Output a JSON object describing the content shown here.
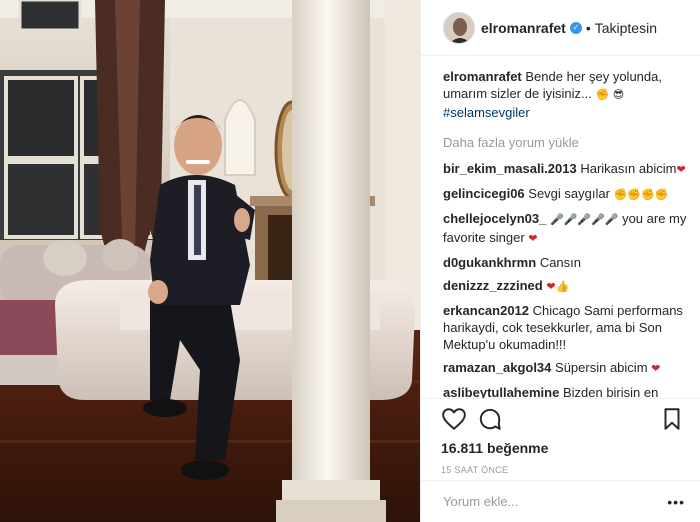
{
  "colors": {
    "link": "#003569",
    "verified": "#3897f0",
    "muted": "#999999",
    "text": "#262626"
  },
  "post": {
    "author": "elromanrafet",
    "follow_status": "Takiptesin",
    "dot": "•",
    "caption": {
      "user": "elromanrafet",
      "text": "Bende her şey yolunda, umarım sizler de iyisiniz...",
      "emojis": [
        "fist-emoji",
        "sunglasses-emoji"
      ],
      "hashtag": "#selamsevgiler"
    },
    "load_more": "Daha fazla yorum yükle",
    "comments": [
      {
        "user": "bir_ekim_masali.2013",
        "text": "Harikasın abicim",
        "emoji": "❤"
      },
      {
        "user": "gelincicegi06",
        "text": "Sevgi saygılar",
        "emoji": "✊✊✊✊"
      },
      {
        "user": "chellejocelyn03_",
        "text": "you are my favorite singer",
        "emoji_pre": "🎤🎤🎤🎤🎤",
        "emoji": "❤"
      },
      {
        "user": "d0gukankhrmn",
        "text": "Cansın",
        "emoji": ""
      },
      {
        "user": "denizzz_zzzined",
        "text": "",
        "emoji": "❤👍"
      },
      {
        "user": "erkancan2012",
        "text": "Chicago Sami performans harikaydi, cok tesekkurler, ama bi Son Mektup'u okumadin!!!",
        "emoji": ""
      },
      {
        "user": "ramazan_akgol34",
        "text": "Süpersin abicim",
        "emoji": "❤"
      },
      {
        "user": "aslibeytullahemine",
        "text": "Bizden birisin en çokta bu hayranlık yapıyor ... doğal alçak gönüllü halktan gelen ve geldiği yeri unutmayan bi",
        "emoji": ""
      }
    ],
    "likes": "16.811 beğenme",
    "time": "15 SAAT ÖNCE",
    "add_comment_placeholder": "Yorum ekle...",
    "more": "•••"
  }
}
